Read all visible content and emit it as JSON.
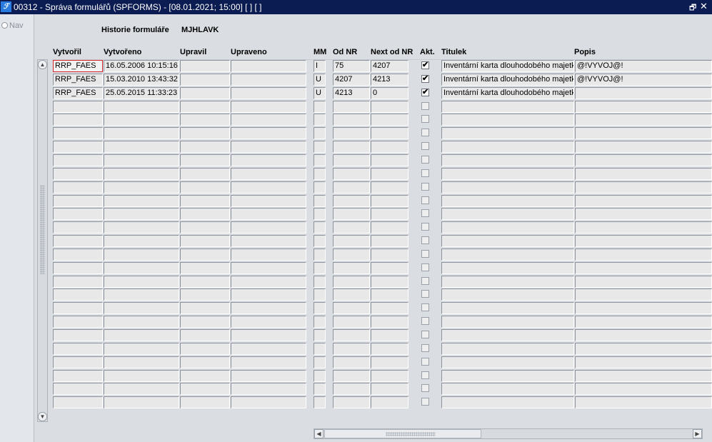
{
  "window": {
    "title": "00312 - Správa formulářů (SPFORMS) - [08.01.2021; 15:00]  [ ]  [ ]",
    "restore_glyph": "🗗",
    "close_glyph": "✕"
  },
  "nav": {
    "label": "Nav"
  },
  "header": {
    "history_label": "Historie formuláře",
    "form_code": "MJHLAVK"
  },
  "columns": {
    "vytvoril": "Vytvořil",
    "vytvoreno": "Vytvořeno",
    "upravil": "Upravil",
    "upraveno": "Upraveno",
    "mm": "MM",
    "od_nr": "Od NR",
    "next_od_nr": "Next od NR",
    "akt": "Akt.",
    "titulek": "Titulek",
    "popis": "Popis"
  },
  "rows": [
    {
      "vytvoril": "RRP_FAES",
      "vytvoreno": "16.05.2006 10:15:16",
      "upravil": "",
      "upraveno": "",
      "mm": "I",
      "od_nr": "75",
      "next_od_nr": "4207",
      "akt": true,
      "titulek": "Inventární karta dlouhodobého majetku",
      "popis": "@!VYVOJ@!"
    },
    {
      "vytvoril": "RRP_FAES",
      "vytvoreno": "15.03.2010 13:43:32",
      "upravil": "",
      "upraveno": "",
      "mm": "U",
      "od_nr": "4207",
      "next_od_nr": "4213",
      "akt": true,
      "titulek": "Inventární karta dlouhodobého majetku",
      "popis": "@!VYVOJ@!"
    },
    {
      "vytvoril": "RRP_FAES",
      "vytvoreno": "25.05.2015 11:33:23",
      "upravil": "",
      "upraveno": "",
      "mm": "U",
      "od_nr": "4213",
      "next_od_nr": "0",
      "akt": true,
      "titulek": "Inventární karta dlouhodobého majetku",
      "popis": ""
    },
    {
      "vytvoril": "",
      "vytvoreno": "",
      "upravil": "",
      "upraveno": "",
      "mm": "",
      "od_nr": "",
      "next_od_nr": "",
      "akt": false,
      "titulek": "",
      "popis": ""
    },
    {
      "vytvoril": "",
      "vytvoreno": "",
      "upravil": "",
      "upraveno": "",
      "mm": "",
      "od_nr": "",
      "next_od_nr": "",
      "akt": false,
      "titulek": "",
      "popis": ""
    },
    {
      "vytvoril": "",
      "vytvoreno": "",
      "upravil": "",
      "upraveno": "",
      "mm": "",
      "od_nr": "",
      "next_od_nr": "",
      "akt": false,
      "titulek": "",
      "popis": ""
    },
    {
      "vytvoril": "",
      "vytvoreno": "",
      "upravil": "",
      "upraveno": "",
      "mm": "",
      "od_nr": "",
      "next_od_nr": "",
      "akt": false,
      "titulek": "",
      "popis": ""
    },
    {
      "vytvoril": "",
      "vytvoreno": "",
      "upravil": "",
      "upraveno": "",
      "mm": "",
      "od_nr": "",
      "next_od_nr": "",
      "akt": false,
      "titulek": "",
      "popis": ""
    },
    {
      "vytvoril": "",
      "vytvoreno": "",
      "upravil": "",
      "upraveno": "",
      "mm": "",
      "od_nr": "",
      "next_od_nr": "",
      "akt": false,
      "titulek": "",
      "popis": ""
    },
    {
      "vytvoril": "",
      "vytvoreno": "",
      "upravil": "",
      "upraveno": "",
      "mm": "",
      "od_nr": "",
      "next_od_nr": "",
      "akt": false,
      "titulek": "",
      "popis": ""
    },
    {
      "vytvoril": "",
      "vytvoreno": "",
      "upravil": "",
      "upraveno": "",
      "mm": "",
      "od_nr": "",
      "next_od_nr": "",
      "akt": false,
      "titulek": "",
      "popis": ""
    },
    {
      "vytvoril": "",
      "vytvoreno": "",
      "upravil": "",
      "upraveno": "",
      "mm": "",
      "od_nr": "",
      "next_od_nr": "",
      "akt": false,
      "titulek": "",
      "popis": ""
    },
    {
      "vytvoril": "",
      "vytvoreno": "",
      "upravil": "",
      "upraveno": "",
      "mm": "",
      "od_nr": "",
      "next_od_nr": "",
      "akt": false,
      "titulek": "",
      "popis": ""
    },
    {
      "vytvoril": "",
      "vytvoreno": "",
      "upravil": "",
      "upraveno": "",
      "mm": "",
      "od_nr": "",
      "next_od_nr": "",
      "akt": false,
      "titulek": "",
      "popis": ""
    },
    {
      "vytvoril": "",
      "vytvoreno": "",
      "upravil": "",
      "upraveno": "",
      "mm": "",
      "od_nr": "",
      "next_od_nr": "",
      "akt": false,
      "titulek": "",
      "popis": ""
    },
    {
      "vytvoril": "",
      "vytvoreno": "",
      "upravil": "",
      "upraveno": "",
      "mm": "",
      "od_nr": "",
      "next_od_nr": "",
      "akt": false,
      "titulek": "",
      "popis": ""
    },
    {
      "vytvoril": "",
      "vytvoreno": "",
      "upravil": "",
      "upraveno": "",
      "mm": "",
      "od_nr": "",
      "next_od_nr": "",
      "akt": false,
      "titulek": "",
      "popis": ""
    },
    {
      "vytvoril": "",
      "vytvoreno": "",
      "upravil": "",
      "upraveno": "",
      "mm": "",
      "od_nr": "",
      "next_od_nr": "",
      "akt": false,
      "titulek": "",
      "popis": ""
    },
    {
      "vytvoril": "",
      "vytvoreno": "",
      "upravil": "",
      "upraveno": "",
      "mm": "",
      "od_nr": "",
      "next_od_nr": "",
      "akt": false,
      "titulek": "",
      "popis": ""
    },
    {
      "vytvoril": "",
      "vytvoreno": "",
      "upravil": "",
      "upraveno": "",
      "mm": "",
      "od_nr": "",
      "next_od_nr": "",
      "akt": false,
      "titulek": "",
      "popis": ""
    },
    {
      "vytvoril": "",
      "vytvoreno": "",
      "upravil": "",
      "upraveno": "",
      "mm": "",
      "od_nr": "",
      "next_od_nr": "",
      "akt": false,
      "titulek": "",
      "popis": ""
    },
    {
      "vytvoril": "",
      "vytvoreno": "",
      "upravil": "",
      "upraveno": "",
      "mm": "",
      "od_nr": "",
      "next_od_nr": "",
      "akt": false,
      "titulek": "",
      "popis": ""
    },
    {
      "vytvoril": "",
      "vytvoreno": "",
      "upravil": "",
      "upraveno": "",
      "mm": "",
      "od_nr": "",
      "next_od_nr": "",
      "akt": false,
      "titulek": "",
      "popis": ""
    },
    {
      "vytvoril": "",
      "vytvoreno": "",
      "upravil": "",
      "upraveno": "",
      "mm": "",
      "od_nr": "",
      "next_od_nr": "",
      "akt": false,
      "titulek": "",
      "popis": ""
    },
    {
      "vytvoril": "",
      "vytvoreno": "",
      "upravil": "",
      "upraveno": "",
      "mm": "",
      "od_nr": "",
      "next_od_nr": "",
      "akt": false,
      "titulek": "",
      "popis": ""
    },
    {
      "vytvoril": "",
      "vytvoreno": "",
      "upravil": "",
      "upraveno": "",
      "mm": "",
      "od_nr": "",
      "next_od_nr": "",
      "akt": false,
      "titulek": "",
      "popis": ""
    }
  ],
  "scroll": {
    "up_glyph": "▲",
    "down_glyph": "▼",
    "left_glyph": "◀",
    "right_glyph": "▶"
  },
  "icons": {
    "app": "forms-app-icon",
    "check": "✔"
  }
}
